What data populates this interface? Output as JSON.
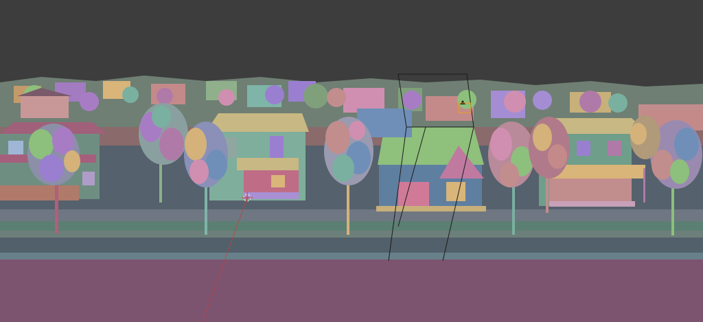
{
  "viewport": {
    "kind": "3d-viewport",
    "shading": "random-color-solid",
    "background_color": "#3d3d3d",
    "ground_colors": {
      "street_far": "#55616d",
      "curb": "#6e7782",
      "grass_strip": "#5c7f73",
      "sidewalk": "#7a8892",
      "road": "#52606b",
      "near_ground": "#7d5470"
    }
  },
  "scene": {
    "objects": {
      "houses_foreground": 4,
      "trees_foreground": 8,
      "camera_frustum": true,
      "cursor_3d": true,
      "selected_object": "camera-gizmo"
    }
  },
  "palette": [
    "#7fa07b",
    "#a87cc4",
    "#c28d8d",
    "#7ab0a0",
    "#d4b27a",
    "#6f8fb8",
    "#b07aa8",
    "#8dc07c",
    "#9a7fd0",
    "#d08fb0"
  ]
}
